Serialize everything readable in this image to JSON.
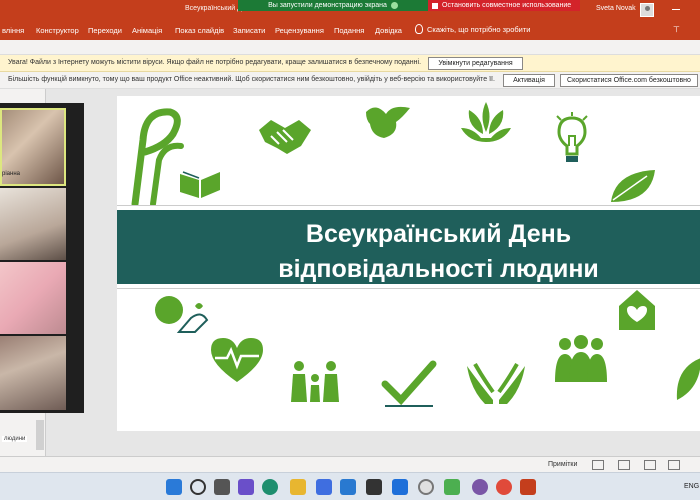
{
  "titlebar": {
    "doc_title": "Всеукраїнський Д...",
    "share_banner": "Вы запустили демонстрацию экрана",
    "stop_sharing": "Остановить совместное использование",
    "user_name": "Sveta Novak"
  },
  "ribbon": {
    "tabs": [
      "вління",
      "Конструктор",
      "Переходи",
      "Анімація",
      "Показ слайдів",
      "Записати",
      "Рецензування",
      "Подання",
      "Довідка"
    ],
    "tell_me": "Скажіть, що потрібно зробити"
  },
  "messages": {
    "protected_view": "Увага! Файли з Інтернету можуть містити віруси. Якщо файл не потрібно редагувати, краще залишатися в безпечному поданні.",
    "enable_editing": "Увімкнути редагування",
    "inactive_notice": "Більшість функцій вимкнуто, тому що ваш продукт Office неактивний. Щоб скористатися ним безкоштовно, увійдіть у веб-версію та використовуйте її.",
    "activate": "Активація",
    "use_free": "Скористатися Office.com безкоштовно"
  },
  "video": {
    "participant_label": "ріанна"
  },
  "thumb": {
    "label": "людини"
  },
  "slide": {
    "title_line1": "Всеукраїнський День",
    "title_line2": "відповідальності людини",
    "colors": {
      "green": "#5aa52b",
      "teal": "#1f5f5b"
    }
  },
  "statusbar": {
    "notes": "Примітки"
  },
  "taskbar": {
    "lang": "ENG"
  }
}
